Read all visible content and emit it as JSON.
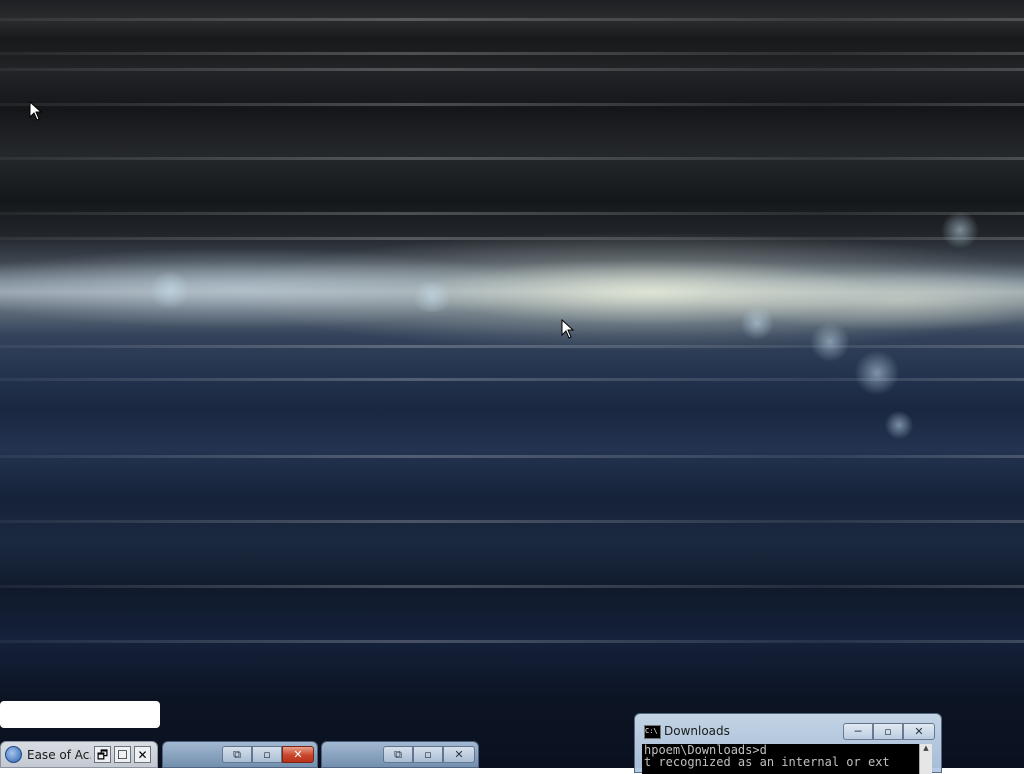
{
  "taskbar": {
    "ease_of_access": {
      "title": "Ease of Ac...",
      "icon": "ease-of-access-icon",
      "restore_glyph": "🗗",
      "maximize_glyph": "☐",
      "close_glyph": "✕"
    },
    "window_1": {
      "restore_glyph": "⧉",
      "maximize_glyph": "▫",
      "close_glyph": "✕"
    },
    "window_2": {
      "restore_glyph": "⧉",
      "maximize_glyph": "▫",
      "close_glyph": "✕"
    }
  },
  "cmd": {
    "title": "Downloads",
    "icon_text": "C:\\",
    "lines": [
      "hpoem\\Downloads>d",
      "t recognized as an internal or ext"
    ],
    "minimize_glyph": "─",
    "maximize_glyph": "▫",
    "close_glyph": "✕"
  },
  "colors": {
    "close_red": "#c8452c",
    "console_bg": "#000000",
    "console_text": "#c0c0c0"
  }
}
